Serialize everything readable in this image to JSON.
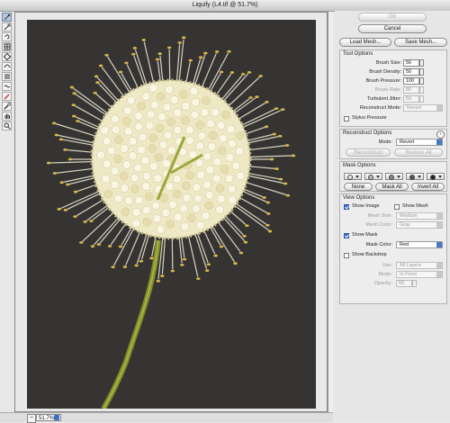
{
  "window": {
    "title": "Liquify (L4.tif @ 51.7%)"
  },
  "toolbar": {
    "tools": [
      {
        "name": "forward-warp-tool-icon",
        "glyph": "warp"
      },
      {
        "name": "reconstruct-tool-icon",
        "glyph": "reconstruct"
      },
      {
        "name": "twirl-clockwise-tool-icon",
        "glyph": "twirl"
      },
      {
        "name": "pucker-tool-icon",
        "glyph": "pucker"
      },
      {
        "name": "bloat-tool-icon",
        "glyph": "bloat"
      },
      {
        "name": "push-left-tool-icon",
        "glyph": "push"
      },
      {
        "name": "mirror-tool-icon",
        "glyph": "mirror"
      },
      {
        "name": "turbulence-tool-icon",
        "glyph": "turbulence"
      },
      {
        "name": "freeze-mask-tool-icon",
        "glyph": "freeze"
      },
      {
        "name": "thaw-mask-tool-icon",
        "glyph": "thaw"
      },
      {
        "name": "hand-tool-icon",
        "glyph": "hand"
      },
      {
        "name": "zoom-tool-icon",
        "glyph": "zoom"
      }
    ]
  },
  "status": {
    "zoom": "51.7%"
  },
  "buttons": {
    "ok": "OK",
    "cancel": "Cancel",
    "load_mesh": "Load Mesh...",
    "save_mesh": "Save Mesh..."
  },
  "tool_options": {
    "title": "Tool Options",
    "brush_size": {
      "label": "Brush Size:",
      "value": "56"
    },
    "brush_density": {
      "label": "Brush Density:",
      "value": "50"
    },
    "brush_pressure": {
      "label": "Brush Pressure:",
      "value": "100"
    },
    "brush_rate": {
      "label": "Brush Rate:",
      "value": "80"
    },
    "turbulent_jitter": {
      "label": "Turbulent Jitter:",
      "value": "50"
    },
    "reconstruct_mode": {
      "label": "Reconstruct Mode:",
      "value": "Revert"
    },
    "stylus_pressure": {
      "label": "Stylus Pressure",
      "checked": false
    }
  },
  "reconstruct_options": {
    "title": "Reconstruct Options",
    "mode": {
      "label": "Mode:",
      "value": "Revert"
    },
    "reconstruct_label": "Reconstruct",
    "restore_all_label": "Restore All"
  },
  "mask_options": {
    "title": "Mask Options",
    "none_label": "None",
    "mask_all_label": "Mask All",
    "invert_all_label": "Invert All"
  },
  "view_options": {
    "title": "View Options",
    "show_image": {
      "label": "Show Image",
      "checked": true
    },
    "show_mesh": {
      "label": "Show Mesh",
      "checked": false
    },
    "mesh_size": {
      "label": "Mesh Size:",
      "value": "Medium"
    },
    "mesh_color": {
      "label": "Mesh Color:",
      "value": "Gray"
    },
    "show_mask": {
      "label": "Show Mask",
      "checked": true
    },
    "mask_color": {
      "label": "Mask Color:",
      "value": "Red"
    },
    "show_backdrop": {
      "label": "Show Backdrop",
      "checked": false
    },
    "use": {
      "label": "Use:",
      "value": "All Layers"
    },
    "mode": {
      "label": "Mode:",
      "value": "In Front"
    },
    "opacity": {
      "label": "Opacity:",
      "value": "50"
    }
  },
  "colors": {
    "canvas_bg": "#353433",
    "accent": "#3d70cf",
    "flower_petals": "#f3ecc8",
    "stem": "#8c9a2c"
  }
}
